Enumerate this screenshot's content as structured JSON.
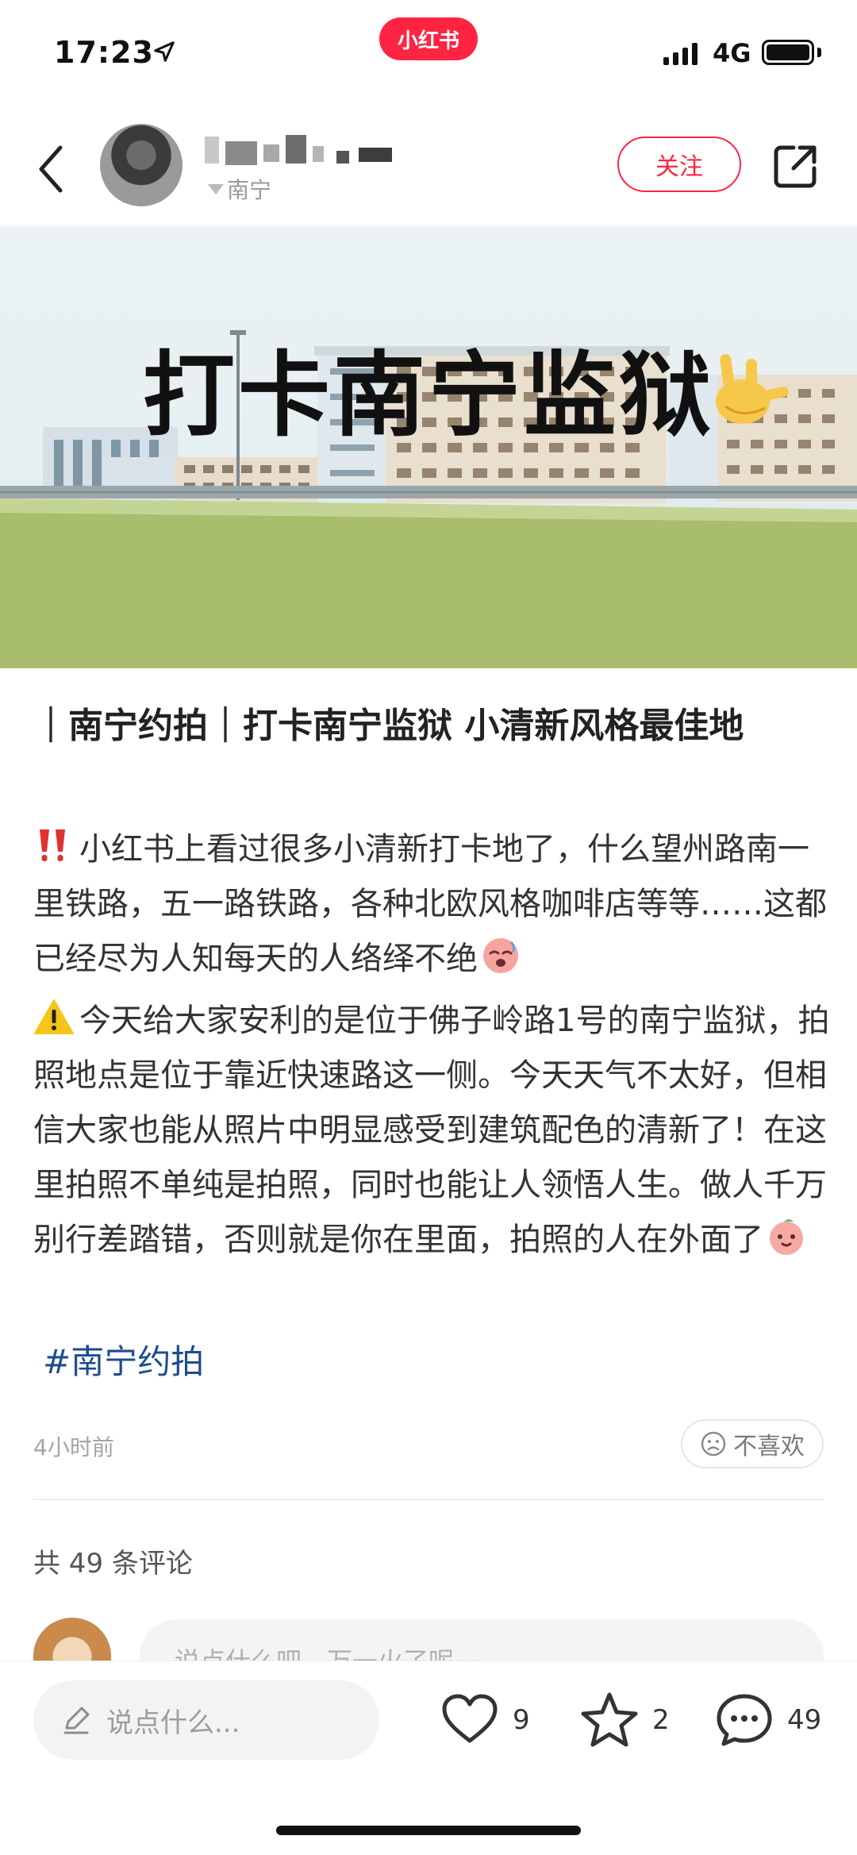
{
  "status_bar": {
    "time": "17:23",
    "app_badge": "小红书",
    "network": "4G"
  },
  "header": {
    "author_location": "南宁",
    "follow_label": "关注"
  },
  "hero": {
    "title": "打卡南宁监狱",
    "emoji": "love-you-hand"
  },
  "post": {
    "title": "｜南宁约拍｜打卡南宁监狱 小清新风格最佳地",
    "paragraph1": "小红书上看过很多小清新打卡地了，什么望州路南一里铁路，五一路铁路，各种北欧风格咖啡店等等……这都已经尽为人知每天的人络绎不绝",
    "paragraph2": "今天给大家安利的是位于佛子岭路1号的南宁监狱，拍照地点是位于靠近快速路这一侧。今天天气不太好，但相信大家也能从照片中明显感受到建筑配色的清新了！在这里拍照不单纯是拍照，同时也能让人领悟人生。做人千万别行差踏错，否则就是你在里面，拍照的人在外面了",
    "hashtag": "#南宁约拍",
    "time_ago": "4小时前",
    "dislike_label": "不喜欢"
  },
  "comments": {
    "count_label": "共 49 条评论",
    "preview_placeholder": "说点什么吧，万一火了呢~"
  },
  "bottom_bar": {
    "input_placeholder": "说点什么...",
    "likes": "9",
    "collects": "2",
    "comments": "49"
  },
  "colors": {
    "brand": "#ff2442",
    "hashtag": "#1d4c8c"
  }
}
